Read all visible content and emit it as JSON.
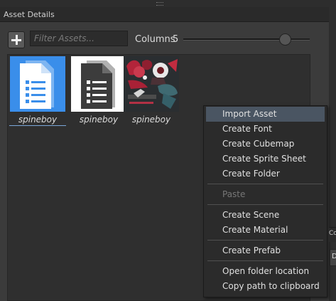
{
  "window": {
    "title": "Asset Details"
  },
  "toolbar": {
    "add_icon": "plus-icon",
    "filter_placeholder": "Filter Assets...",
    "columns_label": "Columns",
    "columns_value": "5",
    "columns_min": 1,
    "columns_max": 6
  },
  "assets": [
    {
      "name": "spineboy",
      "kind": "document",
      "selected": true,
      "color": "#3a8eea"
    },
    {
      "name": "spineboy",
      "kind": "document",
      "selected": false,
      "color": "#3c3c3c"
    },
    {
      "name": "spineboy",
      "kind": "atlas-image",
      "selected": false
    }
  ],
  "context_menu": {
    "items": [
      {
        "label": "Import Asset",
        "state": "hover"
      },
      {
        "label": "Create Font"
      },
      {
        "label": "Create Cubemap"
      },
      {
        "label": "Create Sprite Sheet"
      },
      {
        "label": "Create Folder"
      },
      {
        "label": "Paste",
        "state": "disabled"
      },
      {
        "label": "Create Scene"
      },
      {
        "label": "Create Material"
      },
      {
        "label": "Create Prefab"
      },
      {
        "label": "Open folder location"
      },
      {
        "label": "Copy path to clipboard"
      }
    ]
  },
  "side_panel": {
    "tab_text": "Co",
    "button_text": "D"
  },
  "colors": {
    "background": "#3b3b3b",
    "panel": "#2f2f2f",
    "selection": "#3a8eea",
    "menu_hover": "#4a5562"
  }
}
